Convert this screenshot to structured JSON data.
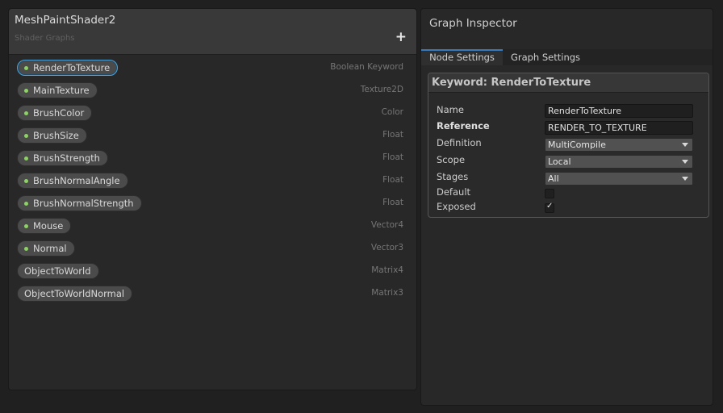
{
  "blackboard": {
    "title": "MeshPaintShader2",
    "subtitle": "Shader Graphs",
    "add_button": "+",
    "properties": [
      {
        "name": "RenderToTexture",
        "type": "Boolean Keyword",
        "exposed": true,
        "selected": true
      },
      {
        "name": "MainTexture",
        "type": "Texture2D",
        "exposed": true
      },
      {
        "name": "BrushColor",
        "type": "Color",
        "exposed": true
      },
      {
        "name": "BrushSize",
        "type": "Float",
        "exposed": true
      },
      {
        "name": "BrushStrength",
        "type": "Float",
        "exposed": true
      },
      {
        "name": "BrushNormalAngle",
        "type": "Float",
        "exposed": true
      },
      {
        "name": "BrushNormalStrength",
        "type": "Float",
        "exposed": true
      },
      {
        "name": "Mouse",
        "type": "Vector4",
        "exposed": true
      },
      {
        "name": "Normal",
        "type": "Vector3",
        "exposed": true
      },
      {
        "name": "ObjectToWorld",
        "type": "Matrix4",
        "exposed": false
      },
      {
        "name": "ObjectToWorldNormal",
        "type": "Matrix3",
        "exposed": false
      }
    ]
  },
  "inspector": {
    "title": "Graph Inspector",
    "tabs": [
      "Node Settings",
      "Graph Settings"
    ],
    "active_tab": "Node Settings",
    "keyword_title": "Keyword: RenderToTexture",
    "fields": {
      "name_label": "Name",
      "name_value": "RenderToTexture",
      "reference_label": "Reference",
      "reference_value": "RENDER_TO_TEXTURE",
      "definition_label": "Definition",
      "definition_value": "MultiCompile",
      "scope_label": "Scope",
      "scope_value": "Local",
      "stages_label": "Stages",
      "stages_value": "All",
      "default_label": "Default",
      "default_checked": false,
      "exposed_label": "Exposed",
      "exposed_checked": true
    },
    "checkmark_glyph": "✓"
  },
  "colors": {
    "accent": "#3a79bb",
    "keyword_dot": "#8fd067",
    "selection_outline": "#4fa3d6"
  }
}
